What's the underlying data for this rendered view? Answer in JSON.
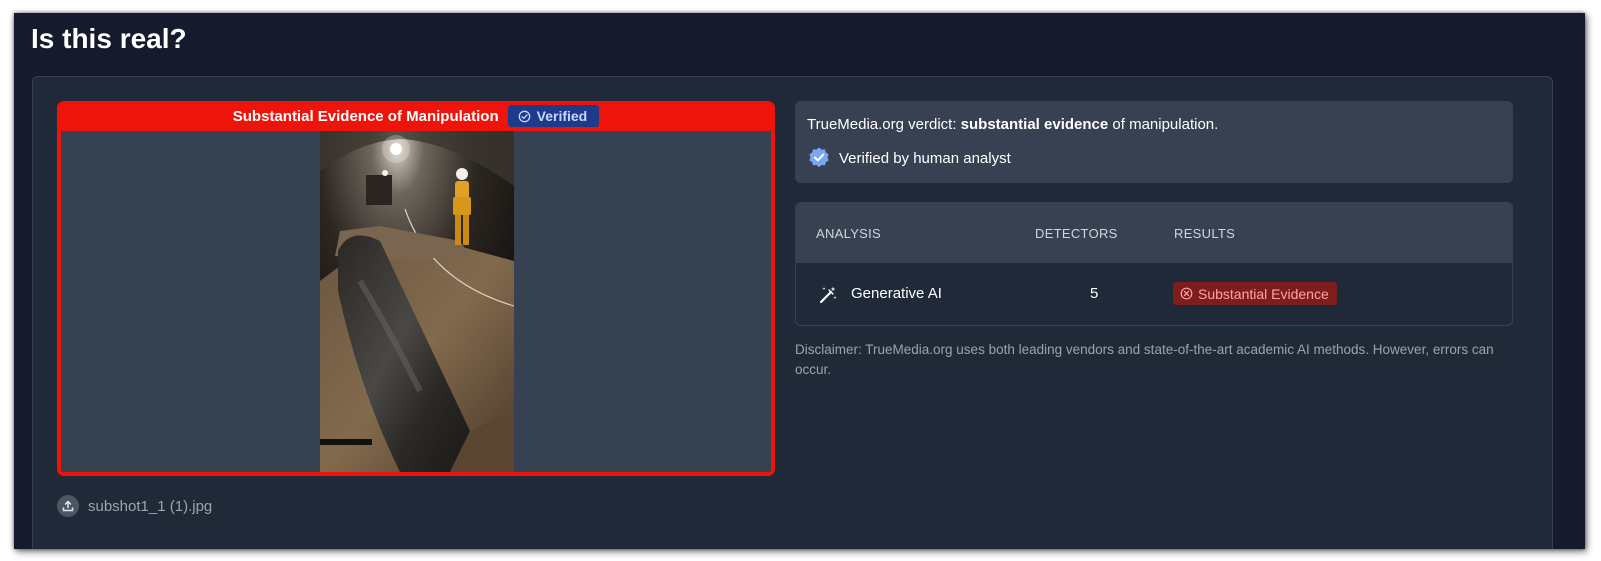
{
  "page": {
    "title": "Is this real?"
  },
  "media": {
    "verdict_label": "Substantial Evidence of Manipulation",
    "verified_badge": "Verified",
    "file_name": "subshot1_1 (1).jpg",
    "frame_color": "#ee140b"
  },
  "verdict": {
    "prefix": "TrueMedia.org verdict: ",
    "strong": "substantial evidence",
    "suffix": " of manipulation.",
    "human_label": "Verified by human analyst"
  },
  "analysis": {
    "headers": {
      "analysis": "ANALYSIS",
      "detectors": "DETECTORS",
      "results": "RESULTS"
    },
    "rows": [
      {
        "name": "Generative AI",
        "detectors": "5",
        "result": "Substantial Evidence",
        "icon": "magic-wand-icon"
      }
    ]
  },
  "disclaimer": "Disclaimer: TrueMedia.org uses both leading vendors and state-of-the-art academic AI methods. However, errors can occur.",
  "colors": {
    "background": "#151b2c",
    "card": "#1f2937",
    "panel": "#374151",
    "badge_bg": "#7f1d1d",
    "badge_text": "#fca5a5",
    "verified_chip": "#1e3a8a"
  }
}
